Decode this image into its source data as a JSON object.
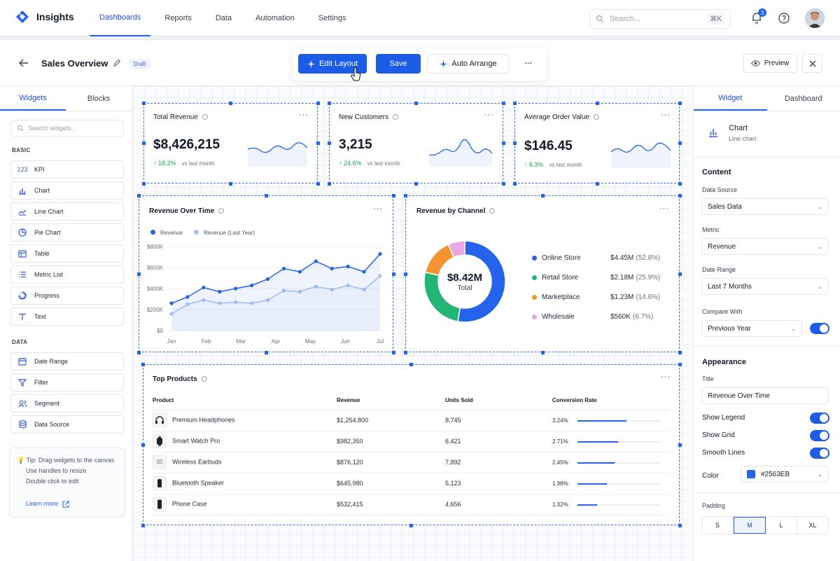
{
  "app": {
    "name": "Insights"
  },
  "nav": {
    "items": [
      "Dashboards",
      "Reports",
      "Data",
      "Automation",
      "Settings"
    ],
    "active": 0
  },
  "search": {
    "placeholder": "Search...",
    "shortcut": "⌘K"
  },
  "notifications": {
    "count": "3"
  },
  "page": {
    "title": "Sales Overview",
    "status": "Draft"
  },
  "toolbar": {
    "edit_layout": "Edit Layout",
    "save": "Save",
    "auto_arrange": "Auto Arrange",
    "more": "···"
  },
  "header_actions": {
    "preview": "Preview"
  },
  "left_sidebar": {
    "tabs": [
      "Widgets",
      "Blocks"
    ],
    "search_placeholder": "Search widgets...",
    "basic_label": "BASIC",
    "basic_items": [
      {
        "label": "KPI",
        "icon": "kpi-icon"
      },
      {
        "label": "Chart",
        "icon": "bar-chart-icon"
      },
      {
        "label": "Line Chart",
        "icon": "line-chart-icon"
      },
      {
        "label": "Pie Chart",
        "icon": "pie-chart-icon"
      },
      {
        "label": "Table",
        "icon": "table-icon"
      },
      {
        "label": "Metric List",
        "icon": "list-icon"
      },
      {
        "label": "Progress",
        "icon": "progress-icon"
      },
      {
        "label": "Text",
        "icon": "text-icon"
      }
    ],
    "data_label": "DATA",
    "data_items": [
      {
        "label": "Date Range",
        "icon": "calendar-icon"
      },
      {
        "label": "Filter",
        "icon": "filter-icon"
      },
      {
        "label": "Segment",
        "icon": "users-icon"
      },
      {
        "label": "Data Source",
        "icon": "database-icon"
      }
    ],
    "tip": {
      "title": "Tip: Drag widgets to the canvas",
      "line2": "Use handles to resize",
      "line3": "Double click to edit",
      "link": "Learn more"
    }
  },
  "kpis": [
    {
      "title": "Total Revenue",
      "value": "$8,426,215",
      "delta": "18.2%",
      "vs": "vs last month"
    },
    {
      "title": "New Customers",
      "value": "3,215",
      "delta": "24.6%",
      "vs": "vs last month"
    },
    {
      "title": "Average Order Value",
      "value": "$146.45",
      "delta": "6.3%",
      "vs": "vs last month"
    }
  ],
  "revenue_chart": {
    "title": "Revenue Over Time",
    "chart_data": {
      "type": "line",
      "categories": [
        "Jan",
        "",
        "Feb",
        "",
        "Mar",
        "",
        "Apr",
        "",
        "May",
        "",
        "Jun",
        "",
        "Jul"
      ],
      "x_tick_labels": [
        "Jan",
        "Feb",
        "Mar",
        "Apr",
        "May",
        "Jun",
        "Jul"
      ],
      "y_tick_labels": [
        "$0",
        "$200K",
        "$400K",
        "$600K",
        "$800K"
      ],
      "ylim": [
        0,
        800000
      ],
      "series": [
        {
          "name": "Revenue",
          "color": "#2563eb",
          "values": [
            260000,
            320000,
            410000,
            370000,
            400000,
            430000,
            490000,
            590000,
            560000,
            660000,
            590000,
            610000,
            560000,
            730000
          ]
        },
        {
          "name": "Revenue (Last Year)",
          "color": "#a9c4f5",
          "values": [
            160000,
            250000,
            290000,
            260000,
            270000,
            260000,
            290000,
            380000,
            370000,
            420000,
            390000,
            430000,
            390000,
            520000
          ]
        }
      ]
    }
  },
  "channel_chart": {
    "title": "Revenue by Channel",
    "center_value": "$8.42M",
    "center_label": "Total",
    "chart_data": {
      "type": "pie",
      "slices": [
        {
          "name": "Online Store",
          "value": "$4.45M",
          "pct": "(52.8%)",
          "share": 52.8,
          "color": "#2563eb"
        },
        {
          "name": "Retail Store",
          "value": "$2.18M",
          "pct": "(25.9%)",
          "share": 25.9,
          "color": "#22b573"
        },
        {
          "name": "Marketplace",
          "value": "$1.23M",
          "pct": "(14.6%)",
          "share": 14.6,
          "color": "#f59331"
        },
        {
          "name": "Wholesale",
          "value": "$560K",
          "pct": "(6.7%)",
          "share": 6.7,
          "color": "#e9a8e4"
        }
      ]
    }
  },
  "products": {
    "title": "Top Products",
    "columns": [
      "Product",
      "Revenue",
      "Units Sold",
      "Conversion Rate"
    ],
    "rows": [
      {
        "name": "Premium Headphones",
        "revenue": "$1,254,800",
        "units": "8,745",
        "rate": "3.24%",
        "rate_value": 3.24,
        "icon": "headphones-icon"
      },
      {
        "name": "Smart Watch Pro",
        "revenue": "$982,350",
        "units": "6,421",
        "rate": "2.71%",
        "rate_value": 2.71,
        "icon": "watch-icon"
      },
      {
        "name": "Wireless Earbuds",
        "revenue": "$876,120",
        "units": "7,892",
        "rate": "2.45%",
        "rate_value": 2.45,
        "icon": "earbuds-icon"
      },
      {
        "name": "Bluetooth Speaker",
        "revenue": "$645,980",
        "units": "5,123",
        "rate": "1.98%",
        "rate_value": 1.98,
        "icon": "speaker-icon"
      },
      {
        "name": "Phone Case",
        "revenue": "$532,415",
        "units": "4,656",
        "rate": "1.32%",
        "rate_value": 1.32,
        "icon": "phone-icon"
      }
    ]
  },
  "right_sidebar": {
    "tabs": [
      "Widget",
      "Dashboard"
    ],
    "widget_type": "Chart",
    "widget_subtype": "Line chart",
    "content_heading": "Content",
    "data_source_label": "Data Source",
    "data_source": "Sales Data",
    "metric_label": "Metric",
    "metric": "Revenue",
    "date_range_label": "Date Range",
    "date_range": "Last 7 Months",
    "compare_label": "Compare With",
    "compare": "Previous Year",
    "appearance_heading": "Appearance",
    "title_label": "Title",
    "title_value": "Revenue Over Time",
    "show_legend": "Show Legend",
    "show_grid": "Show Grid",
    "smooth_lines": "Smooth Lines",
    "color_label": "Color",
    "color_value": "#2563EB",
    "padding_label": "Padding",
    "padding_options": [
      "S",
      "M",
      "L",
      "XL"
    ],
    "padding_selected": "M"
  }
}
